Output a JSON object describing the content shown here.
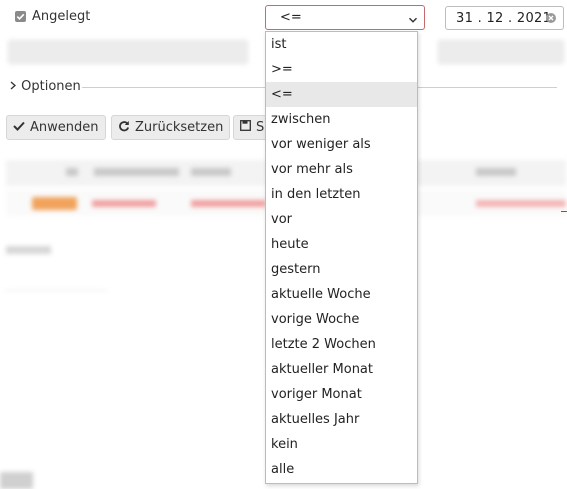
{
  "filter": {
    "field_label": "Angelegt",
    "operator_value": "<=",
    "date_value": "31 . 12 . 2021"
  },
  "options_section": {
    "label": "Optionen"
  },
  "toolbar": {
    "apply_label": "Anwenden",
    "reset_label": "Zurücksetzen",
    "save_label_partial": "S"
  },
  "dropdown": {
    "selected_index": 2,
    "options": [
      "ist",
      ">=",
      "<=",
      "zwischen",
      "vor weniger als",
      "vor mehr als",
      "in den letzten",
      "vor",
      "heute",
      "gestern",
      "aktuelle Woche",
      "vorige Woche",
      "letzte 2 Wochen",
      "aktueller Monat",
      "voriger Monat",
      "aktuelles Jahr",
      "kein",
      "alle"
    ]
  },
  "icons": {
    "checkbox": "checkbox-checked-icon",
    "chevron": "chevron-down-icon",
    "clear": "clear-circle-icon",
    "expander": "chevron-right-icon",
    "apply": "check-icon",
    "reset": "refresh-icon",
    "save": "floppy-icon"
  },
  "colors": {
    "select_border": "#c46a6a",
    "selected_option_bg": "#e8e8e8",
    "link_red": "#c0392b"
  }
}
